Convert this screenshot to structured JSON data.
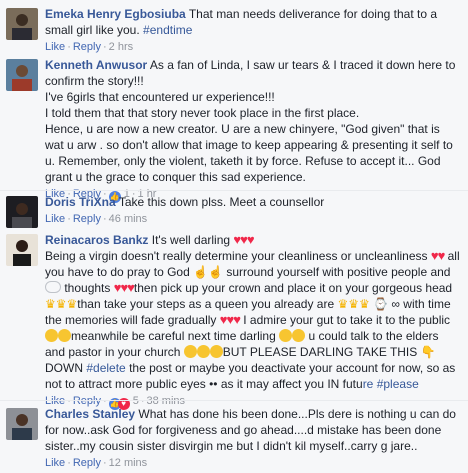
{
  "comments": [
    {
      "author": "Emeka Henry Egbosiuba",
      "text": "That man needs deliverance for doing that to a small girl like you.",
      "hashtag": "#endtime",
      "like": "Like",
      "reply": "Reply",
      "time": "2 hrs"
    },
    {
      "author": "Kenneth Anwusor",
      "line1": "As a fan of Linda, I saw ur tears & I traced it down here to confirm the story!!!",
      "line2": "I've 6girls that encountered ur experience!!!",
      "line3": "I told them that that story never took place in the first place.",
      "line4": "Hence, u are now a new creator. U are a new chinyere, \"God given\" that is wat u arw . so don't allow that image to keep appearing & presenting it self to u. Remember, only the violent, taketh it by force. Refuse to accept it... God grant u the grace to conquer this sad experience.",
      "like": "Like",
      "reply": "Reply",
      "reactions": "1",
      "time": "1 hr"
    },
    {
      "author": "Doris TriXna",
      "text": "Take this down plss. Meet a counsellor",
      "like": "Like",
      "reply": "Reply",
      "time": "46 mins"
    },
    {
      "author": "Reinacaros Bankz",
      "t1": "It's well darling",
      "t2": "Being a virgin doesn't really determine your cleanliness or uncleanliness",
      "t3": "all you have to do pray to God",
      "t4": "surround yourself with positive people and",
      "t5": "thoughts",
      "t6": "then pick up your crown and place it on your gorgeous head",
      "t7": "than take your steps as a queen you already are",
      "t8": "with time the memories will fade gradually",
      "t9": "I admire your gut to take it to the public",
      "t10": "meanwhile be careful next time darling",
      "t11": "u could talk to the elders and pastor in your church",
      "t12": "BUT PLEASE DARLING TAKE THIS",
      "t13": "DOWN",
      "t14": "#delete",
      "t15": "the post or maybe you deactivate your account for now, so as not to attract more public eyes",
      "t16": "as it may affect you IN futu",
      "t17": "re",
      "t18": "#please",
      "like": "Like",
      "reply": "Reply",
      "reactions": "5",
      "time": "38 mins"
    },
    {
      "author": "Charles Stanley",
      "text": "What has done his been done...Pls dere is nothing u can do for now..ask God for forgiveness and go ahead....d mistake has been done sister..my cousin sister disvirgin me but I didn't kil myself..carry g jare..",
      "like": "Like",
      "reply": "Reply",
      "time": "12 mins"
    }
  ]
}
